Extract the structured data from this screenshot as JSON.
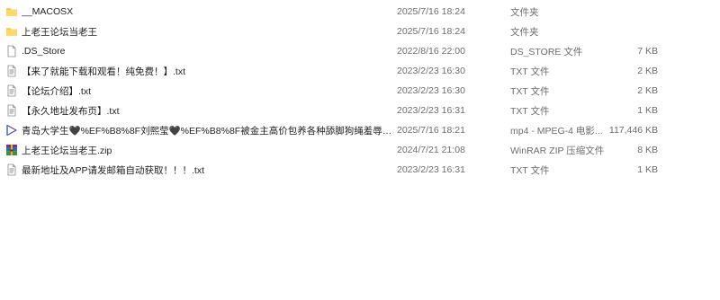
{
  "files": [
    {
      "name": "__MACOSX",
      "date": "2025/7/16 18:24",
      "type": "文件夹",
      "size": "",
      "icon": "folder-icon"
    },
    {
      "name": "上老王论坛当老王",
      "date": "2025/7/16 18:24",
      "type": "文件夹",
      "size": "",
      "icon": "folder-icon"
    },
    {
      "name": ".DS_Store",
      "date": "2022/8/16 22:00",
      "type": "DS_STORE 文件",
      "size": "7 KB",
      "icon": "file-icon"
    },
    {
      "name": "【来了就能下载和观看！纯免费！】.txt",
      "date": "2023/2/23 16:30",
      "type": "TXT 文件",
      "size": "2 KB",
      "icon": "text-file-icon"
    },
    {
      "name": "【论坛介绍】.txt",
      "date": "2023/2/23 16:30",
      "type": "TXT 文件",
      "size": "2 KB",
      "icon": "text-file-icon"
    },
    {
      "name": "【永久地址发布页】.txt",
      "date": "2023/2/23 16:31",
      "type": "TXT 文件",
      "size": "1 KB",
      "icon": "text-file-icon"
    },
    {
      "name": "青岛大学生🖤%EF%B8%8F刘熙莹🖤%EF%B8%8F被金主高价包养各种舔脚狗绳羞辱玩弄.mp4",
      "date": "2025/7/16 18:21",
      "type": "mp4 - MPEG-4 电影...",
      "size": "117,446 KB",
      "icon": "video-file-icon"
    },
    {
      "name": "上老王论坛当老王.zip",
      "date": "2024/7/21 21:08",
      "type": "WinRAR ZIP 压缩文件",
      "size": "8 KB",
      "icon": "zip-archive-icon"
    },
    {
      "name": "最新地址及APP请发邮箱自动获取！！！.txt",
      "date": "2023/2/23 16:31",
      "type": "TXT 文件",
      "size": "1 KB",
      "icon": "text-file-icon"
    }
  ]
}
